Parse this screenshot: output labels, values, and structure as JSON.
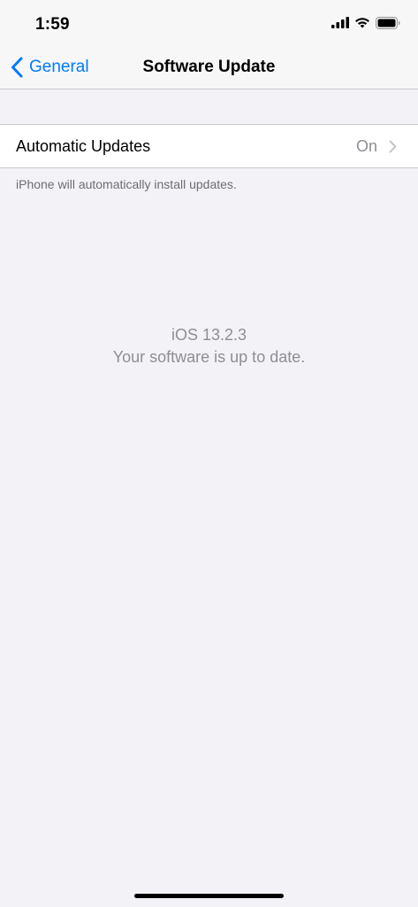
{
  "status_bar": {
    "time": "1:59",
    "icons": [
      "cellular-signal-icon",
      "wifi-icon",
      "battery-icon"
    ]
  },
  "nav": {
    "back_label": "General",
    "title": "Software Update"
  },
  "settings": {
    "automatic_updates": {
      "label": "Automatic Updates",
      "value": "On"
    },
    "footer_note": "iPhone will automatically install updates."
  },
  "software": {
    "version": "iOS 13.2.3",
    "status": "Your software is up to date."
  },
  "colors": {
    "accent": "#007aff",
    "background": "#f2f2f7",
    "secondary_text": "#8e8e93"
  }
}
